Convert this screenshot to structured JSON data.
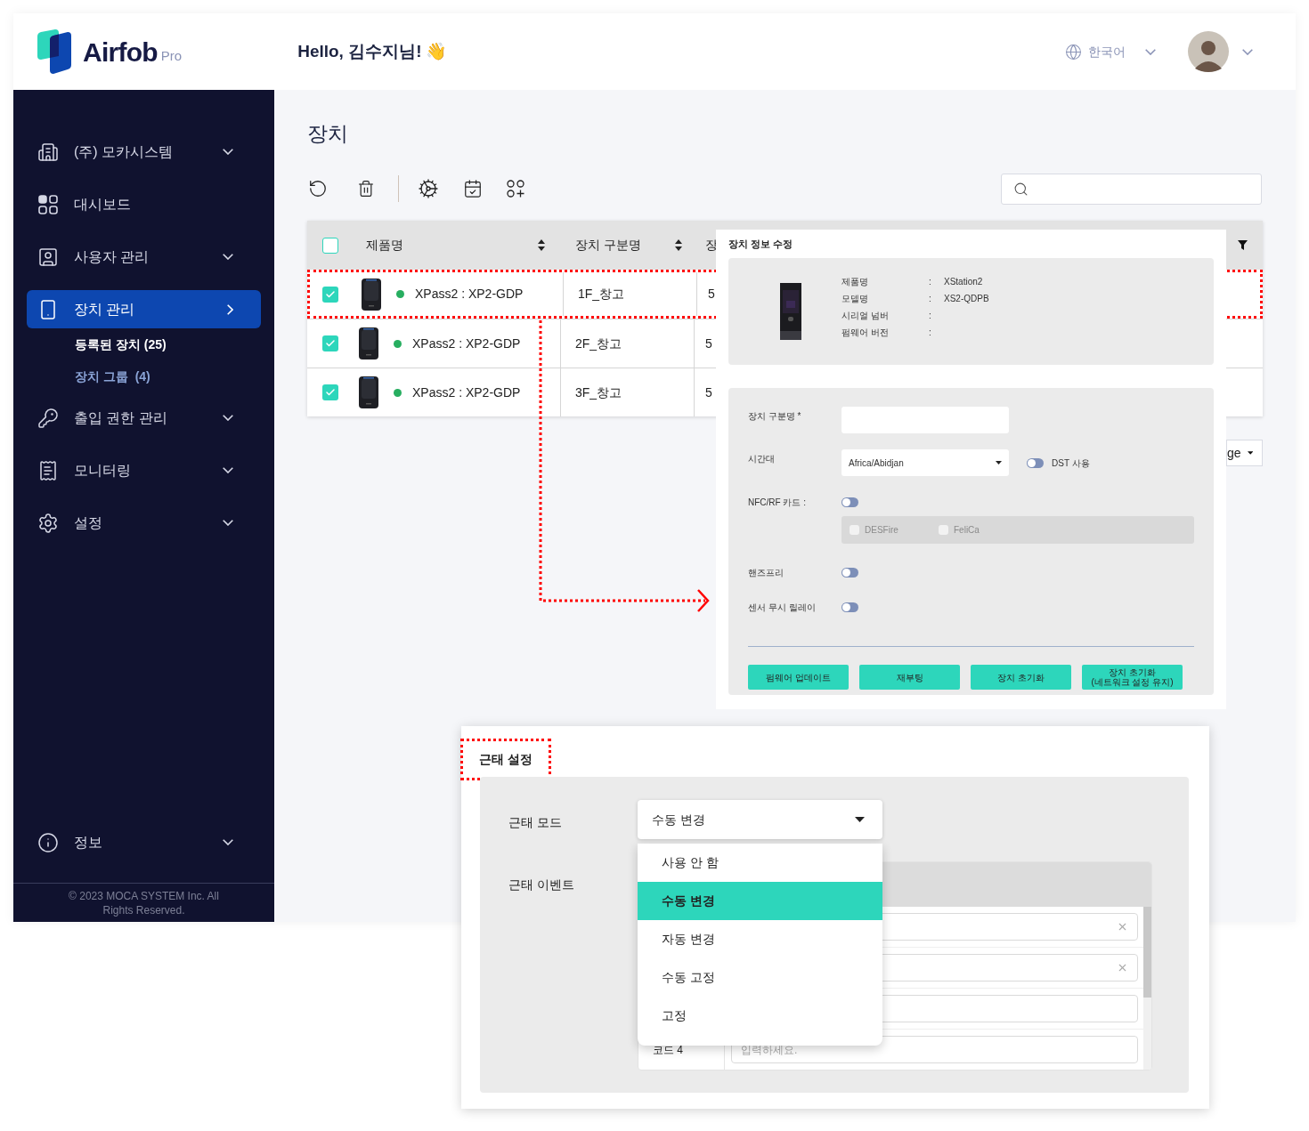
{
  "header": {
    "logo": "Airfob",
    "logo_suffix": "Pro",
    "greeting": "Hello, 김수지님!",
    "greeting_emoji": "👋",
    "language": "한국어"
  },
  "sidebar": {
    "items": [
      {
        "label": "(주) 모카시스템",
        "selected": false,
        "expanded": false
      },
      {
        "label": "대시보드",
        "selected": false
      },
      {
        "label": "사용자 관리",
        "selected": false,
        "expanded": false
      },
      {
        "label": "장치 관리",
        "selected": true,
        "expanded": true,
        "children": [
          {
            "label": "등록된 장치 (25)",
            "selected": true
          },
          {
            "label": "장치 그룹  (4)",
            "selected": false
          }
        ]
      },
      {
        "label": "출입 권한 관리",
        "selected": false,
        "expanded": false
      },
      {
        "label": "모니터링",
        "selected": false,
        "expanded": false
      },
      {
        "label": "설정",
        "selected": false,
        "expanded": false
      }
    ],
    "bottom_items": [
      {
        "label": "정보",
        "selected": false,
        "expanded": false
      }
    ],
    "footer": "© 2023 MOCA SYSTEM Inc. All Rights Reserved."
  },
  "page": {
    "title": "장치"
  },
  "table": {
    "header_checked": false,
    "columns": [
      {
        "label": "제품명",
        "sortable": true
      },
      {
        "label": "장치 구분명",
        "sortable": true
      },
      {
        "label": "장",
        "sortable": false
      }
    ],
    "rows": [
      {
        "checked": true,
        "highlighted": true,
        "color": "#27ae60",
        "product": "XPass2 : XP2-GDP",
        "label": "1F_창고",
        "column_3": "5"
      },
      {
        "checked": true,
        "highlighted": false,
        "color": "#27ae60",
        "product": "XPass2 : XP2-GDP",
        "label": "2F_창고",
        "column_3": "5"
      },
      {
        "checked": true,
        "highlighted": false,
        "color": "#27ae60",
        "product": "XPass2 : XP2-GDP",
        "label": "3F_창고",
        "column_3": "5"
      }
    ]
  },
  "page_size_select": {
    "value": "ge"
  },
  "device_edit": {
    "title": "장치 정보 수정",
    "info": [
      {
        "label": "제품명",
        "sep": ":",
        "value": "XStation2"
      },
      {
        "label": "모델명",
        "sep": ":",
        "value": "XS2-QDPB"
      },
      {
        "label": "시리얼 넘버",
        "sep": ":"
      },
      {
        "label": "펌웨어 버전",
        "sep": ":"
      }
    ],
    "fields": [
      {
        "kind": "input",
        "label": "장치 구분명 *"
      },
      {
        "kind": "select",
        "label": "시간대",
        "value": "Africa/Abidjan",
        "toggle": {
          "label": "DST 사용",
          "on": false
        }
      },
      {
        "kind": "toggle",
        "label": "NFC/RF 카드 :",
        "on": false,
        "options": [
          {
            "label": "DESFire",
            "checked": false,
            "disabled": true
          },
          {
            "label": "FeliCa",
            "checked": false,
            "disabled": true
          }
        ]
      },
      {
        "kind": "toggle",
        "label": "핸즈프리",
        "on": false
      },
      {
        "kind": "toggle",
        "label": "센서 무시 릴레이",
        "on": false
      }
    ],
    "buttons": [
      "펌웨어 업데이트",
      "재부팅",
      "장치 초기화",
      "장치 초기화\n(네트워크 설정 유지)"
    ]
  },
  "attendance": {
    "title": "근태 설정",
    "highlighted": true,
    "mode": {
      "label": "근태 모드",
      "value": "수동 변경",
      "open": true,
      "options": [
        {
          "label": "사용 안 함",
          "selected": false
        },
        {
          "label": "수동 변경",
          "selected": true
        },
        {
          "label": "자동 변경",
          "selected": false
        },
        {
          "label": "수동 고정",
          "selected": false
        },
        {
          "label": "고정",
          "selected": false
        }
      ]
    },
    "events": {
      "label": "근태 이벤트",
      "rows": [
        {
          "clearable": true
        },
        {
          "clearable": true
        },
        {
          "clearable": false
        },
        {
          "code": "코드 4",
          "placeholder": "입력하세요.",
          "clearable": false
        }
      ]
    }
  }
}
